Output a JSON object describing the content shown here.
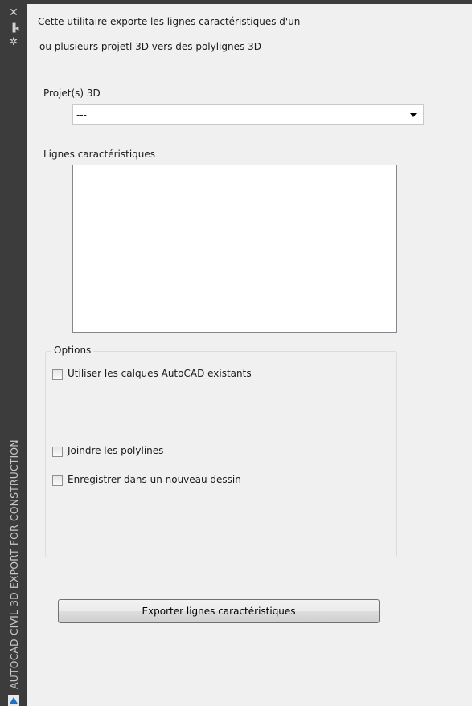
{
  "sidebar": {
    "title": "AUTOCAD CIVIL 3D EXPORT FOR CONSTRUCTION",
    "icons": [
      "close-icon",
      "pin-icon",
      "settings-icon"
    ]
  },
  "description": {
    "line1": "Cette utilitaire exporte les lignes caractéristiques d'un",
    "line2": "ou plusieurs projetl 3D vers des polylignes 3D"
  },
  "projects": {
    "label": "Projet(s) 3D",
    "selected": "---"
  },
  "feature_lines": {
    "label": "Lignes caractéristiques",
    "items": []
  },
  "options": {
    "legend": "Options",
    "use_existing_layers": {
      "label": "Utiliser les calques AutoCAD existants",
      "checked": false
    },
    "join_polylines": {
      "label": "Joindre les polylines",
      "checked": false
    },
    "save_new_drawing": {
      "label": "Enregistrer dans un nouveau dessin",
      "checked": false
    }
  },
  "export_button": {
    "label": "Exporter lignes caractéristiques"
  }
}
